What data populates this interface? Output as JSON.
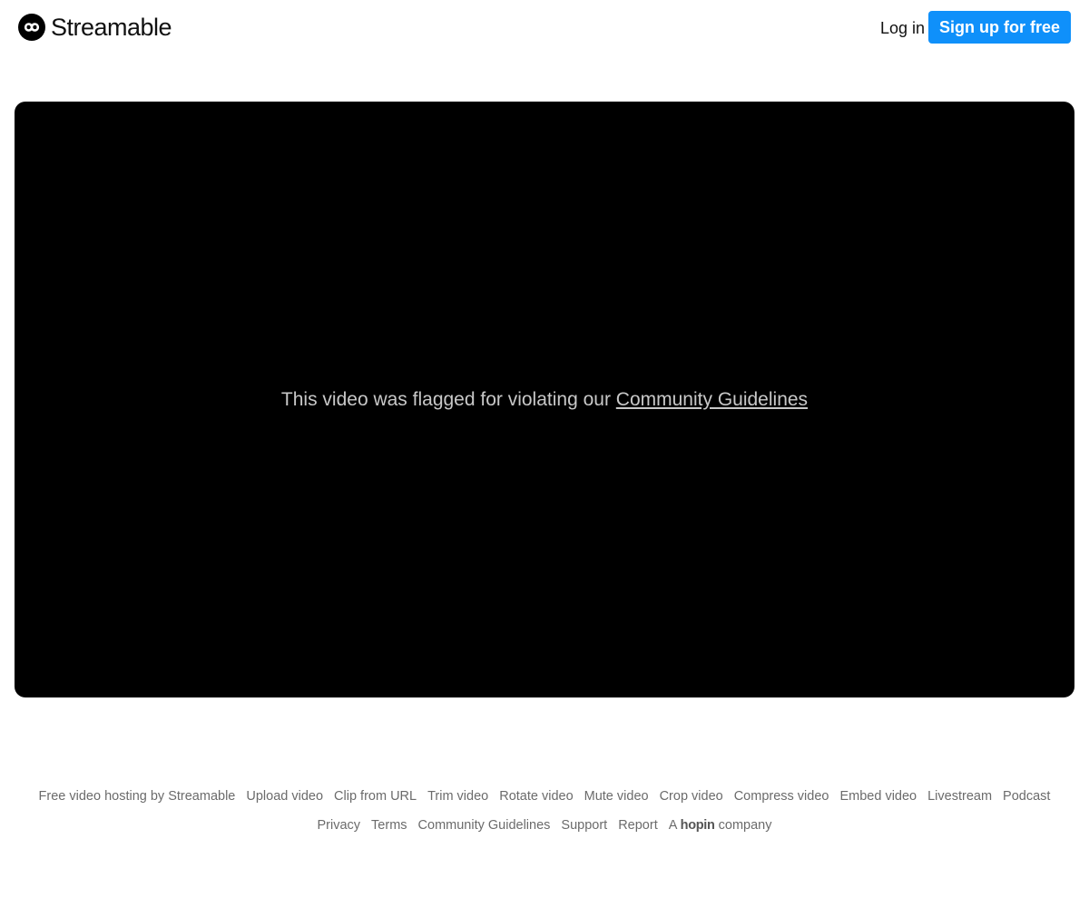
{
  "header": {
    "logo_text": "Streamable",
    "login_label": "Log in",
    "signup_label": "Sign up for free"
  },
  "video": {
    "message": "This video was flagged for violating our ",
    "link_text": "Community Guidelines"
  },
  "footer": {
    "row1": [
      "Free video hosting by Streamable",
      "Upload video",
      "Clip from URL",
      "Trim video",
      "Rotate video",
      "Mute video",
      "Crop video",
      "Compress video",
      "Embed video",
      "Livestream",
      "Podcast"
    ],
    "row2": [
      "Privacy",
      "Terms",
      "Community Guidelines",
      "Support",
      "Report"
    ],
    "company_prefix": "A",
    "company_brand": "hopin",
    "company_suffix": "company"
  },
  "colors": {
    "accent": "#0f90fa",
    "video_bg": "#000000",
    "footer_text": "#6b6b6b"
  }
}
